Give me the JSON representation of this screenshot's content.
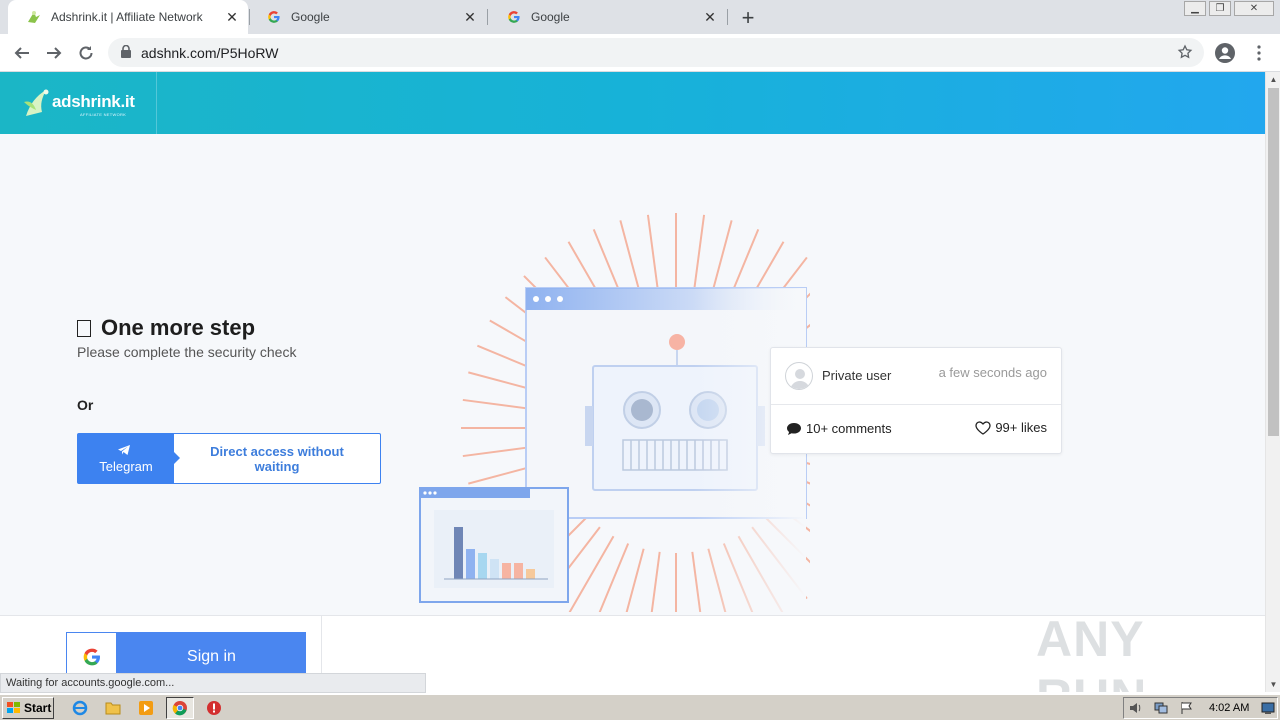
{
  "browser": {
    "tabs": [
      {
        "title": "Adshrink.it | Affiliate Network",
        "active": true
      },
      {
        "title": "Google",
        "active": false
      },
      {
        "title": "Google",
        "active": false
      }
    ],
    "url": "adshnk.com/P5HoRW"
  },
  "site": {
    "logo_text": "adshrink.it",
    "logo_sub": "AFFILIATE NETWORK"
  },
  "main": {
    "heading": "One more step",
    "subtext": "Please complete the security check",
    "or_label": "Or",
    "telegram_label": "Telegram",
    "direct_label": "Direct access without waiting"
  },
  "card": {
    "user": "Private user",
    "time": "a few seconds ago",
    "comments": "10+ comments",
    "likes": "99+ likes"
  },
  "signin": {
    "label": "Sign in"
  },
  "watermark": "ANY RUN",
  "status": "Waiting for accounts.google.com...",
  "taskbar": {
    "start_label": "Start",
    "clock": "4:02 AM"
  },
  "colors": {
    "header_start": "#1bb6c6",
    "header_end": "#22a7ee",
    "accent_blue": "#3d82f0",
    "sunburst": "#f4a58c"
  }
}
